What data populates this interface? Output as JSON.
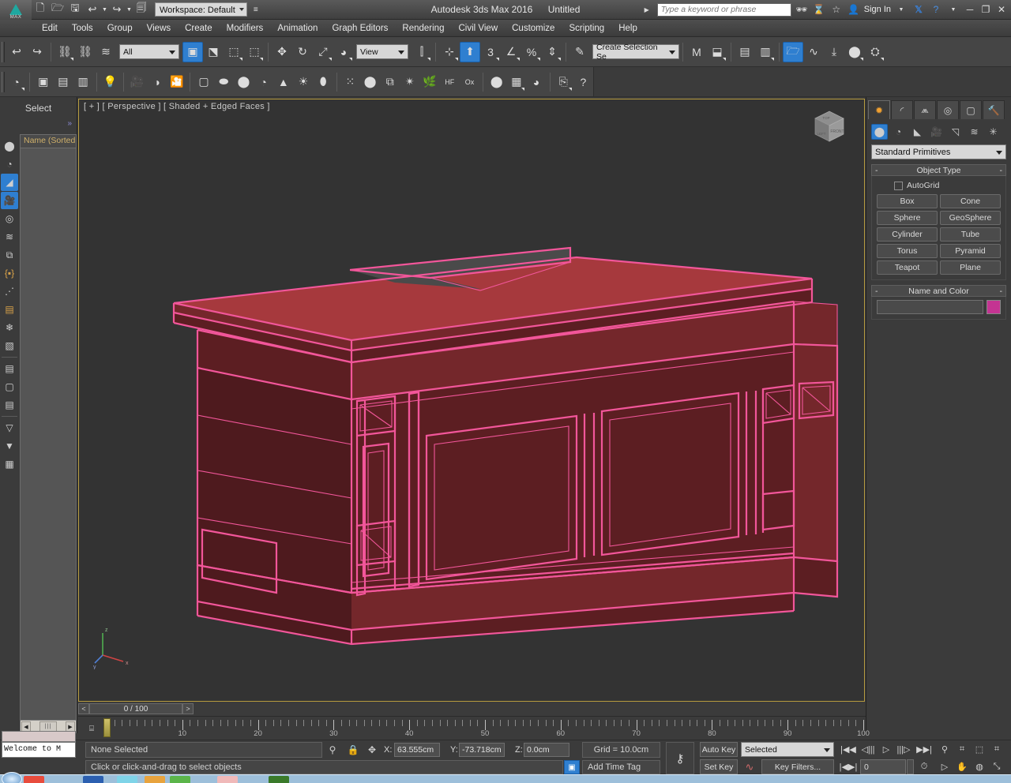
{
  "titlebar": {
    "logo_label": "MAX",
    "quick_access": [
      "new-icon",
      "open-icon",
      "save-icon",
      "undo-icon",
      "undo-dropdown",
      "redo-icon",
      "redo-dropdown",
      "project-folder-icon"
    ],
    "workspace": "Workspace: Default",
    "app_name": "Autodesk 3ds Max 2016",
    "document": "Untitled",
    "search_placeholder": "Type a keyword or phrase",
    "sign_in": "Sign In",
    "icons": [
      "binoculars-icon",
      "subscription-icon",
      "star-icon",
      "user-icon",
      "exchange-icon",
      "help-icon"
    ],
    "window_buttons": [
      "minimize-icon",
      "restore-icon",
      "close-icon"
    ]
  },
  "menubar": {
    "items": [
      "Edit",
      "Tools",
      "Group",
      "Views",
      "Create",
      "Modifiers",
      "Animation",
      "Graph Editors",
      "Rendering",
      "Civil View",
      "Customize",
      "Scripting",
      "Help"
    ]
  },
  "toolbar_main": {
    "selection_filter": "All",
    "reference_coord": "View",
    "selection_set": "Create Selection Se",
    "tools": [
      {
        "name": "undo-icon",
        "glyph": "↩"
      },
      {
        "name": "redo-icon",
        "glyph": "↪"
      },
      {
        "name": "select-and-link-icon",
        "glyph": "⚭"
      },
      {
        "name": "unlink-selection-icon",
        "glyph": "⚮"
      },
      {
        "name": "bind-to-space-warp-icon",
        "glyph": "≈"
      },
      {
        "name": "select-object-icon",
        "glyph": "↖"
      },
      {
        "name": "select-by-name-icon",
        "glyph": "≣"
      },
      {
        "name": "rectangular-selection-region-icon",
        "glyph": "⬚"
      },
      {
        "name": "window-crossing-icon",
        "glyph": "⬛"
      },
      {
        "name": "select-and-move-icon",
        "glyph": "✤"
      },
      {
        "name": "select-and-rotate-icon",
        "glyph": "↻"
      },
      {
        "name": "select-and-scale-icon",
        "glyph": "⤡"
      },
      {
        "name": "use-center-flyout-icon",
        "glyph": "◐"
      },
      {
        "name": "mirror-icon",
        "glyph": "◧"
      },
      {
        "name": "align-icon",
        "glyph": "⬆"
      },
      {
        "name": "snaps-toggle-icon",
        "glyph": "3"
      },
      {
        "name": "angle-snap-toggle-icon",
        "glyph": "∠"
      },
      {
        "name": "percent-snap-toggle-icon",
        "glyph": "%"
      },
      {
        "name": "spinner-snap-toggle-icon",
        "glyph": "↕"
      },
      {
        "name": "named-selection-sets-icon",
        "glyph": "✎"
      },
      {
        "name": "mirror-tool-icon",
        "glyph": "M"
      },
      {
        "name": "align-tool-icon",
        "glyph": "≣"
      },
      {
        "name": "layer-explorer-icon",
        "glyph": "☷"
      },
      {
        "name": "scene-explorer-icon",
        "glyph": "☰"
      },
      {
        "name": "curve-editor-icon",
        "glyph": "∿"
      },
      {
        "name": "schematic-view-icon",
        "glyph": "⤓"
      },
      {
        "name": "material-editor-icon",
        "glyph": "●"
      },
      {
        "name": "render-setup-icon",
        "glyph": "⚒"
      }
    ]
  },
  "toolbar_secondary": {
    "tools": [
      {
        "name": "teapot-icon",
        "glyph": "◔"
      },
      {
        "name": "render-frame-window-icon",
        "glyph": "▣"
      },
      {
        "name": "render-setup-dialog-icon",
        "glyph": "☰"
      },
      {
        "name": "rendered-frame-icon",
        "glyph": "☷"
      },
      {
        "name": "light-lister-icon",
        "glyph": "☀"
      },
      {
        "name": "camera-icon",
        "glyph": "▷"
      },
      {
        "name": "camera-match-icon",
        "glyph": "◑"
      },
      {
        "name": "render-animation-icon",
        "glyph": "◎"
      },
      {
        "name": "plane-primitive-icon",
        "glyph": "□"
      },
      {
        "name": "blob-icon",
        "glyph": "●"
      },
      {
        "name": "sphere-icon",
        "glyph": "●"
      },
      {
        "name": "teapot-primitive-icon",
        "glyph": "◔"
      },
      {
        "name": "cone-icon",
        "glyph": "▲"
      },
      {
        "name": "sun-icon",
        "glyph": "☀"
      },
      {
        "name": "ellipsoid-icon",
        "glyph": "●"
      },
      {
        "name": "particle-icon",
        "glyph": "⁙"
      },
      {
        "name": "dynamics-icon",
        "glyph": "⚫"
      },
      {
        "name": "space-warp-icon",
        "glyph": "⧉"
      },
      {
        "name": "noise-icon",
        "glyph": "✵"
      },
      {
        "name": "grass-icon",
        "glyph": "⸙"
      },
      {
        "name": "hair-and-fur-icon",
        "glyph": "HF"
      },
      {
        "name": "cloth-icon",
        "glyph": "Ox"
      },
      {
        "name": "sphere-gizmo-icon",
        "glyph": "●"
      },
      {
        "name": "material-library-icon",
        "glyph": "☷"
      },
      {
        "name": "environment-icon",
        "glyph": "◕"
      },
      {
        "name": "render-to-texture-icon",
        "glyph": "⎘"
      },
      {
        "name": "help-icon",
        "glyph": "?"
      }
    ]
  },
  "left_panel": {
    "title": "Select",
    "chevron": "»",
    "list_header": "Name (Sorted",
    "icons": [
      {
        "name": "geometry-filter-icon",
        "glyph": "●",
        "active": false
      },
      {
        "name": "shapes-filter-icon",
        "glyph": "◔",
        "active": false
      },
      {
        "name": "lights-filter-icon",
        "glyph": "◢",
        "active": true
      },
      {
        "name": "cameras-filter-icon",
        "glyph": "▷",
        "active": true
      },
      {
        "name": "helpers-filter-icon",
        "glyph": "◎",
        "active": false
      },
      {
        "name": "space-warps-filter-icon",
        "glyph": "≈",
        "active": false
      },
      {
        "name": "groups-filter-icon",
        "glyph": "⧉",
        "active": false
      },
      {
        "name": "xrefs-filter-icon",
        "glyph": "{■}",
        "active": false
      },
      {
        "name": "bones-filter-icon",
        "glyph": "∴",
        "active": false
      },
      {
        "name": "containers-filter-icon",
        "glyph": "▤",
        "active": false
      },
      {
        "name": "particles-filter-icon",
        "glyph": "❄",
        "active": false
      },
      {
        "name": "freeze-filter-icon",
        "glyph": "▧",
        "active": false
      },
      {
        "name": "display-all-icon",
        "glyph": "☰",
        "active": false
      },
      {
        "name": "display-none-icon",
        "glyph": "□",
        "active": false
      },
      {
        "name": "display-invert-icon",
        "glyph": "≡",
        "active": false
      },
      {
        "name": "filter-icon",
        "glyph": "▽",
        "active": false
      },
      {
        "name": "filter-options-icon",
        "glyph": "▼",
        "active": false
      },
      {
        "name": "sort-icon",
        "glyph": "▦",
        "active": false
      }
    ]
  },
  "viewport": {
    "label": "[ + ] [ Perspective ] [ Shaded + Edged Faces ]",
    "background_color": "#333333",
    "border_color": "#b59a3e",
    "viewcube_faces": {
      "top": "TOP",
      "left": "LEFT",
      "front": "FRONT"
    },
    "axis_labels": {
      "x": "x",
      "y": "y",
      "z": "z"
    },
    "model": {
      "name": "executive-desk",
      "face_top_color": "#a6393d",
      "face_side_color": "#6d2428",
      "face_dark_color": "#5a1d21",
      "wireframe_color": "#f2569a",
      "monitor_cutout_color": "#4a4a4a"
    }
  },
  "command_panel": {
    "tabs": [
      {
        "name": "create-tab",
        "glyph": "☀",
        "active": true
      },
      {
        "name": "modify-tab",
        "glyph": "◜",
        "active": false
      },
      {
        "name": "hierarchy-tab",
        "glyph": "⑂",
        "active": false
      },
      {
        "name": "motion-tab",
        "glyph": "◎",
        "active": false
      },
      {
        "name": "display-tab",
        "glyph": "⎕",
        "active": false
      },
      {
        "name": "utilities-tab",
        "glyph": "⚒",
        "active": false
      }
    ],
    "sub_icons": [
      {
        "name": "geometry-icon",
        "glyph": "●",
        "active": true
      },
      {
        "name": "shapes-icon",
        "glyph": "◔",
        "active": false
      },
      {
        "name": "lights-icon",
        "glyph": "◢",
        "active": false
      },
      {
        "name": "cameras-icon",
        "glyph": "▷",
        "active": false
      },
      {
        "name": "helpers-icon",
        "glyph": "◱",
        "active": false
      },
      {
        "name": "space-warps-icon",
        "glyph": "≈",
        "active": false
      },
      {
        "name": "systems-icon",
        "glyph": "✷",
        "active": false
      }
    ],
    "category": "Standard Primitives",
    "object_type": {
      "header": "Object Type",
      "autogrid_label": "AutoGrid",
      "autogrid_checked": false,
      "buttons": [
        "Box",
        "Cone",
        "Sphere",
        "GeoSphere",
        "Cylinder",
        "Tube",
        "Torus",
        "Pyramid",
        "Teapot",
        "Plane"
      ]
    },
    "name_and_color": {
      "header": "Name and Color",
      "name_value": "",
      "swatch_color": "#c43492"
    }
  },
  "timeline": {
    "prev_frame": "<",
    "next_frame": ">",
    "current_display": "0 / 100",
    "handle_position_frame": 0,
    "ruler_labels": [
      "10",
      "20",
      "30",
      "40",
      "50",
      "60",
      "70",
      "80",
      "90",
      "100"
    ],
    "range_start": 0,
    "range_end": 100
  },
  "status_bar": {
    "mini_listener_text": "Welcome to M",
    "selection_status": "None Selected",
    "prompt": "Click or click-and-drag to select objects",
    "icons": [
      {
        "name": "isolate-selection-icon",
        "glyph": "♀"
      },
      {
        "name": "selection-lock-icon",
        "glyph": "⚿"
      },
      {
        "name": "absolute-relative-transform-icon",
        "glyph": "✣"
      }
    ],
    "coords": [
      {
        "label": "X:",
        "value": "63.555cm"
      },
      {
        "label": "Y:",
        "value": "-73.718cm"
      },
      {
        "label": "Z:",
        "value": "0.0cm"
      }
    ],
    "grid": "Grid = 10.0cm",
    "add_time_tag": "Add Time Tag",
    "key_mode_icon": "key-icon",
    "auto_key": "Auto Key",
    "set_key": "Set Key",
    "key_selection": "Selected",
    "key_filters": "Key Filters...",
    "frame_value": "0",
    "playback_buttons": [
      {
        "name": "go-to-start-button",
        "glyph": "|◀◀"
      },
      {
        "name": "previous-frame-button",
        "glyph": "◁|||"
      },
      {
        "name": "play-animation-button",
        "glyph": "▷"
      },
      {
        "name": "next-frame-button",
        "glyph": "|||▷"
      },
      {
        "name": "go-to-end-button",
        "glyph": "▶▶|"
      },
      {
        "name": "key-mode-toggle-button",
        "glyph": "|◀▶|"
      }
    ],
    "nav_buttons": [
      {
        "name": "zoom-button",
        "glyph": "⚲"
      },
      {
        "name": "zoom-all-button",
        "glyph": "⌗"
      },
      {
        "name": "zoom-extents-button",
        "glyph": "⬚"
      },
      {
        "name": "zoom-extents-all-button",
        "glyph": "⌗"
      },
      {
        "name": "time-configuration-button",
        "glyph": "⏱"
      },
      {
        "name": "field-of-view-button",
        "glyph": "▷"
      },
      {
        "name": "pan-view-button",
        "glyph": "✋"
      },
      {
        "name": "orbit-button",
        "glyph": "◍"
      },
      {
        "name": "maximize-viewport-toggle-button",
        "glyph": "⤡"
      }
    ]
  },
  "taskbar": {
    "background_color": "#9dbfda",
    "item_colors": [
      "#e84c3d",
      "#2b5fb0",
      "#7fd4e8",
      "#e8a33d",
      "#5bb54a",
      "#f0b9b9",
      "#3a7a2a"
    ]
  }
}
